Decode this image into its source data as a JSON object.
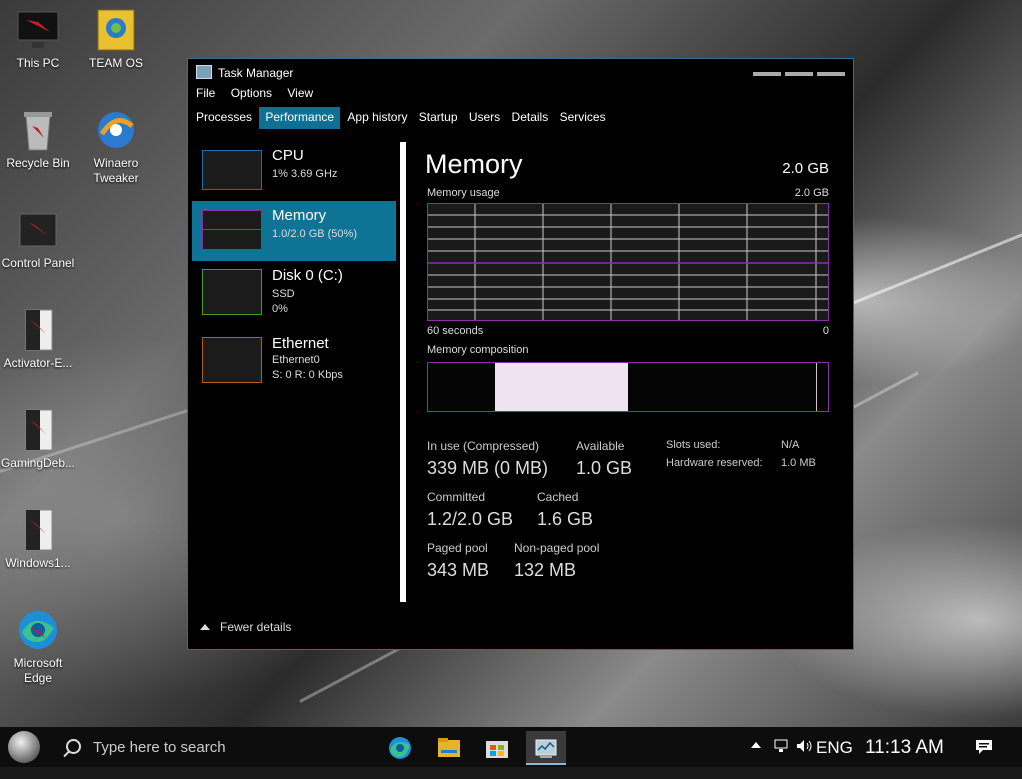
{
  "desktop": {
    "icons": [
      {
        "label": "This PC"
      },
      {
        "label": "TEAM OS"
      },
      {
        "label": "Recycle Bin"
      },
      {
        "label": "Winaero Tweaker"
      },
      {
        "label": "Control Panel"
      },
      {
        "label": "Activator-E..."
      },
      {
        "label": "GamingDeb..."
      },
      {
        "label": "Windows1..."
      },
      {
        "label": "Microsoft Edge"
      }
    ]
  },
  "window": {
    "title": "Task Manager",
    "menu": [
      "File",
      "Options",
      "View"
    ],
    "tabs": [
      "Processes",
      "Performance",
      "App history",
      "Startup",
      "Users",
      "Details",
      "Services"
    ],
    "active_tab": "Performance",
    "sidebar": [
      {
        "name": "CPU",
        "lines": [
          "1%  3.69 GHz"
        ],
        "color": "#1f6fa8"
      },
      {
        "name": "Memory",
        "lines": [
          "1.0/2.0 GB (50%)"
        ],
        "color": "#8b2fa8"
      },
      {
        "name": "Disk 0 (C:)",
        "lines": [
          "SSD",
          "0%"
        ],
        "color": "#4a9a2a"
      },
      {
        "name": "Ethernet",
        "lines": [
          "Ethernet0",
          "S: 0  R: 0 Kbps"
        ],
        "color": "#b0612a"
      }
    ],
    "detail": {
      "title": "Memory",
      "capacity": "2.0 GB",
      "usage_label": "Memory usage",
      "usage_max": "2.0 GB",
      "time_left": "60 seconds",
      "time_right": "0",
      "composition_label": "Memory composition",
      "composition_in_use_fraction": 0.33,
      "stats": {
        "in_use_label": "In use (Compressed)",
        "in_use_value": "339 MB (0 MB)",
        "available_label": "Available",
        "available_value": "1.0 GB",
        "committed_label": "Committed",
        "committed_value": "1.2/2.0 GB",
        "cached_label": "Cached",
        "cached_value": "1.6 GB",
        "paged_label": "Paged pool",
        "paged_value": "343 MB",
        "nonpaged_label": "Non-paged pool",
        "nonpaged_value": "132 MB",
        "slots_label": "Slots used:",
        "slots_value": "N/A",
        "hw_label": "Hardware reserved:",
        "hw_value": "1.0 MB"
      }
    },
    "fewer_details": "Fewer details"
  },
  "taskbar": {
    "search_placeholder": "Type here to search",
    "apps": [
      "edge-icon",
      "file-explorer-icon",
      "store-icon",
      "task-manager-icon"
    ],
    "language": "ENG",
    "time": "11:13 AM"
  }
}
